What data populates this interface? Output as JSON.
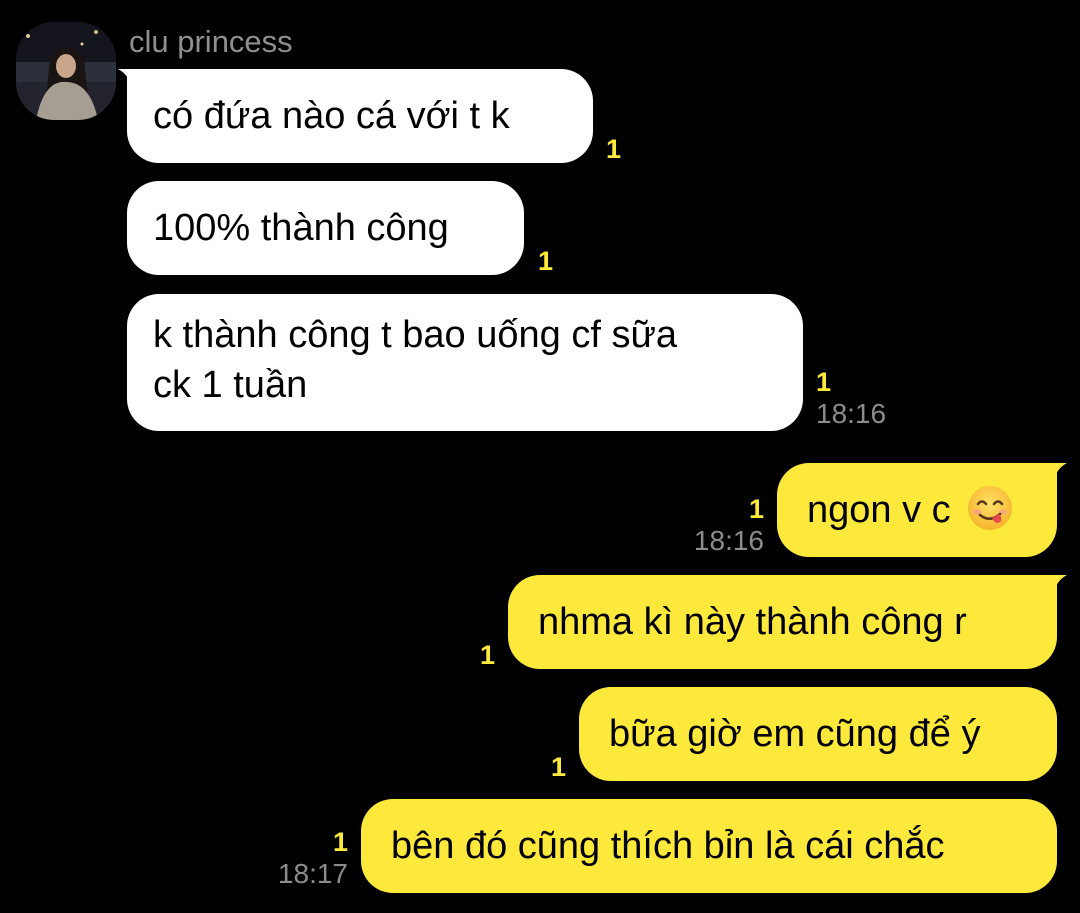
{
  "sender": {
    "name": "clu princess"
  },
  "messages": [
    {
      "text": "có đứa nào cá với t k",
      "unread": "1",
      "time": ""
    },
    {
      "text": "100% thành công",
      "unread": "1",
      "time": ""
    },
    {
      "line1": "k thành công t bao uống cf sữa",
      "line2": "ck 1 tuần",
      "unread": "1",
      "time": "18:16"
    },
    {
      "text": "ngon v c",
      "emoji": "yum-face-emoji",
      "unread": "1",
      "time": "18:16"
    },
    {
      "text": "nhma kì này thành công r",
      "unread": "1",
      "time": ""
    },
    {
      "text": "bữa giờ em cũng để ý",
      "unread": "1",
      "time": ""
    },
    {
      "text": "bên đó cũng thích bỉn là cái chắc",
      "unread": "1",
      "time": "18:17"
    }
  ],
  "colors": {
    "background": "#000000",
    "incoming_bubble": "#ffffff",
    "outgoing_bubble": "#fde93c",
    "unread_count": "#fde93c",
    "meta_text": "#8c8c8c"
  }
}
